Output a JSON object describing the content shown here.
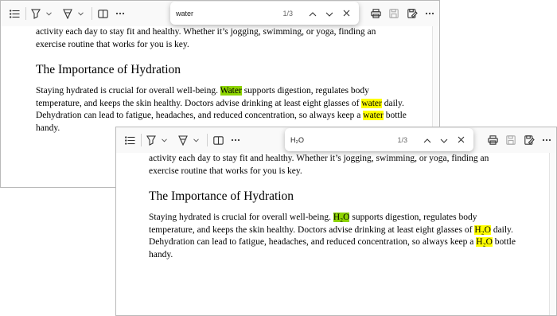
{
  "windows": [
    {
      "id": "back",
      "search": {
        "query": "water",
        "count": "1/3"
      },
      "content": {
        "intro_line1": "activity each day to stay fit and healthy. Whether it’s jogging, swimming, or yoga, finding an",
        "intro_line2": "exercise routine that works for you is key.",
        "heading": "The Importance of Hydration",
        "p_pre1": "Staying hydrated is crucial for overall well-being. ",
        "m1": "Water",
        "p_mid1": " supports digestion, regulates body",
        "p_pre2": "temperature, and keeps the skin healthy. Doctors advise drinking at least eight glasses of ",
        "m2": "water",
        "p_mid2": " daily.",
        "p_pre3": "Dehydration can lead to fatigue, headaches, and reduced concentration, so always keep a ",
        "m3": "water",
        "p_mid3": " bottle",
        "p_line4": "handy."
      }
    },
    {
      "id": "front",
      "search": {
        "query": "H₂O",
        "count": "1/3"
      },
      "content": {
        "intro_line1": "activity each day to stay fit and healthy. Whether it’s jogging, swimming, or yoga, finding an",
        "intro_line2": "exercise routine that works for you is key.",
        "heading": "The Importance of Hydration",
        "p_pre1": "Staying hydrated is crucial for overall well-being. ",
        "m1": "H₂O",
        "p_mid1": " supports digestion, regulates body",
        "p_pre2": "temperature, and keeps the skin healthy. Doctors advise drinking at least eight glasses of ",
        "m2": "H₂O",
        "p_mid2": " daily.",
        "p_pre3": "Dehydration can lead to fatigue, headaches, and reduced concentration, so always keep a ",
        "m3": "H₂O",
        "p_mid3": " bottle",
        "p_line4": "handy."
      }
    }
  ],
  "colors": {
    "current_match": "#8dd400",
    "other_match": "#ffff00",
    "toolbar_bg": "#f9f9f9"
  }
}
